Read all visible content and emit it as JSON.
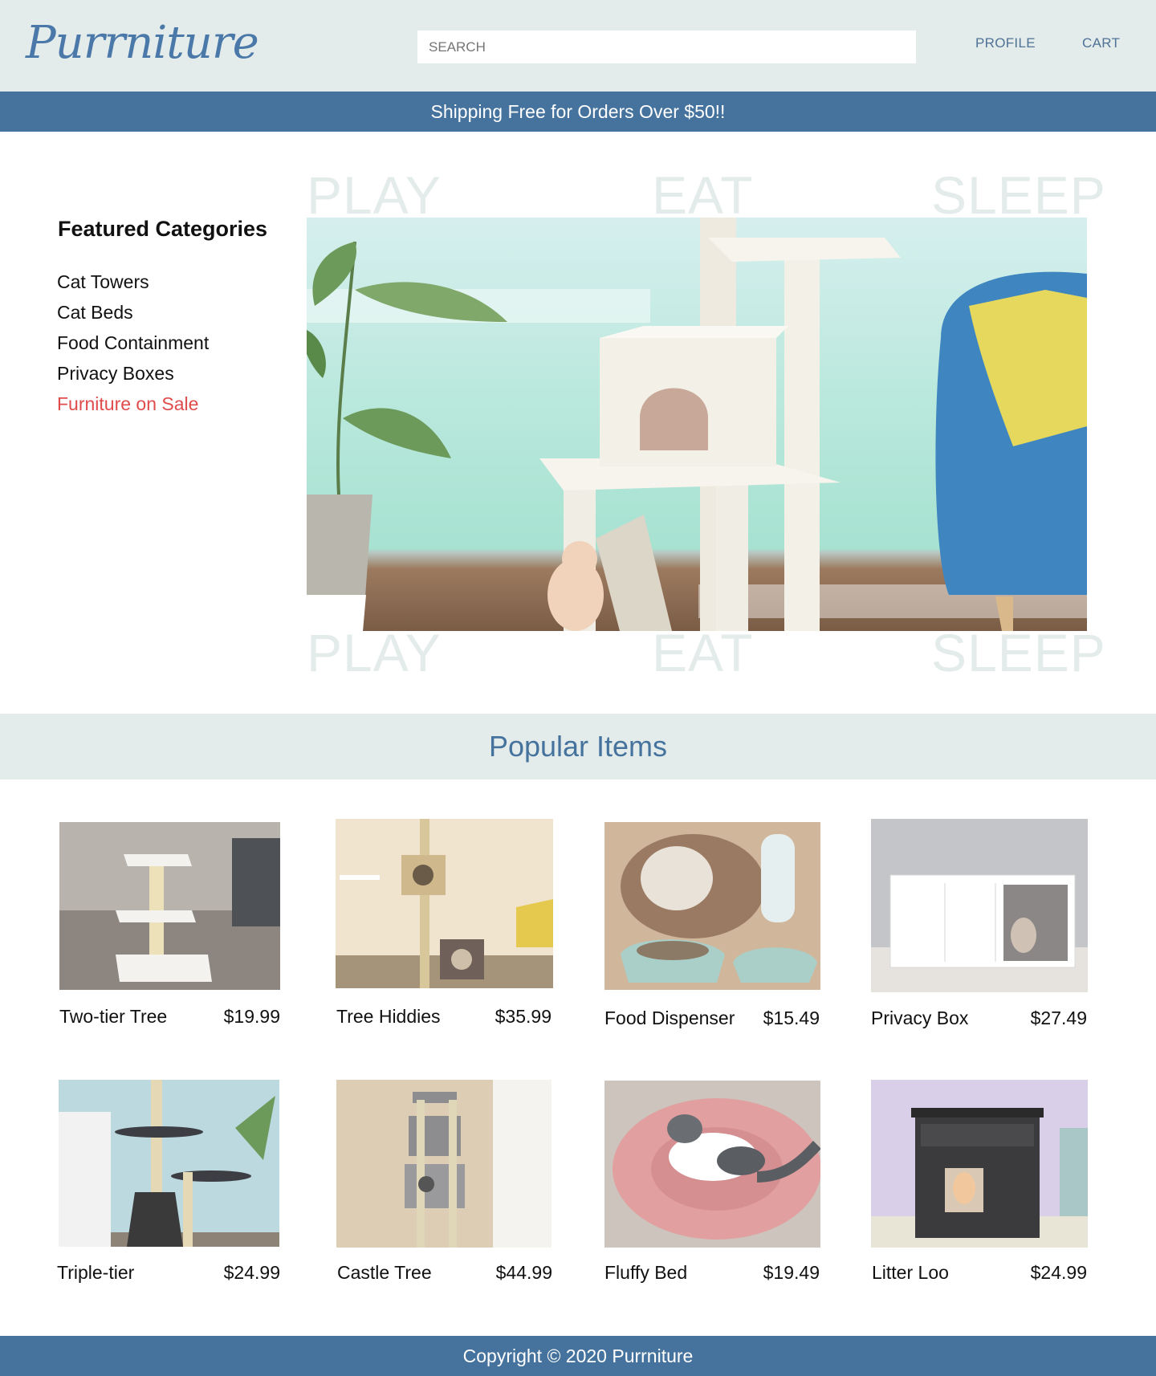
{
  "header": {
    "logo": "Purrniture",
    "search_placeholder": "SEARCH",
    "nav": {
      "profile": "PROFILE",
      "cart": "CART"
    }
  },
  "banner": {
    "text": "Shipping Free for Orders Over $50!!"
  },
  "sidebar": {
    "title": "Featured Categories",
    "items": [
      "Cat Towers",
      "Cat Beds",
      "Food Containment",
      "Privacy Boxes",
      "Furniture on Sale"
    ]
  },
  "hero": {
    "words": [
      "PLAY",
      "EAT",
      "SLEEP"
    ]
  },
  "popular": {
    "title": "Popular Items",
    "products": [
      {
        "name": "Two-tier Tree",
        "price": "$19.99"
      },
      {
        "name": "Tree Hiddies",
        "price": "$35.99"
      },
      {
        "name": "Food Dispenser",
        "price": "$15.49"
      },
      {
        "name": "Privacy Box",
        "price": "$27.49"
      },
      {
        "name": "Triple-tier",
        "price": "$24.99"
      },
      {
        "name": "Castle Tree",
        "price": "$44.99"
      },
      {
        "name": "Fluffy Bed",
        "price": "$19.49"
      },
      {
        "name": "Litter Loo",
        "price": "$24.99"
      }
    ]
  },
  "footer": {
    "text": "Copyright © 2020 Purrniture"
  },
  "colors": {
    "brand_blue": "#46739d",
    "header_bg": "#e3ecea",
    "sale_red": "#e04b4b"
  }
}
